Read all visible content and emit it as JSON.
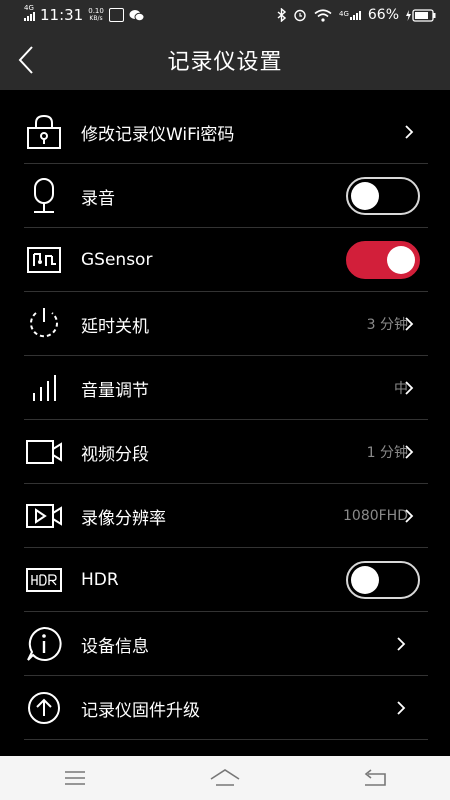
{
  "status_bar": {
    "network": "4G",
    "time": "11:31",
    "speed": "0.10",
    "speed_unit": "KB/s",
    "net_right": "4G",
    "battery": "66%"
  },
  "header": {
    "title": "记录仪设置"
  },
  "settings": [
    {
      "label": "修改记录仪WiFi密码",
      "value": "",
      "icon": "lock-icon",
      "control": "chevron"
    },
    {
      "label": "录音",
      "value": "",
      "icon": "microphone-icon",
      "control": "toggle",
      "toggle_on": false
    },
    {
      "label": "GSensor",
      "value": "",
      "icon": "sensor-chip-icon",
      "control": "toggle",
      "toggle_on": true
    },
    {
      "label": "延时关机",
      "value": "3 分钟",
      "icon": "power-icon",
      "control": "chevron"
    },
    {
      "label": "音量调节",
      "value": "中",
      "icon": "volume-bars-icon",
      "control": "chevron"
    },
    {
      "label": "视频分段",
      "value": "1 分钟",
      "icon": "video-camera-icon",
      "control": "chevron"
    },
    {
      "label": "录像分辨率",
      "value": "1080FHD",
      "icon": "video-play-icon",
      "control": "chevron"
    },
    {
      "label": "HDR",
      "value": "",
      "icon": "hdr-icon",
      "control": "toggle",
      "toggle_on": false
    },
    {
      "label": "设备信息",
      "value": "",
      "icon": "info-icon",
      "control": "chevron"
    },
    {
      "label": "记录仪固件升级",
      "value": "",
      "icon": "upgrade-icon",
      "control": "chevron"
    }
  ],
  "colors": {
    "accent": "#d21f3a",
    "bar_bg": "#2b2b2b",
    "background": "#000000",
    "value_text": "#8a8a8a"
  },
  "nav_bar": {
    "icons": [
      "menu-icon",
      "home-icon",
      "back-icon"
    ]
  }
}
